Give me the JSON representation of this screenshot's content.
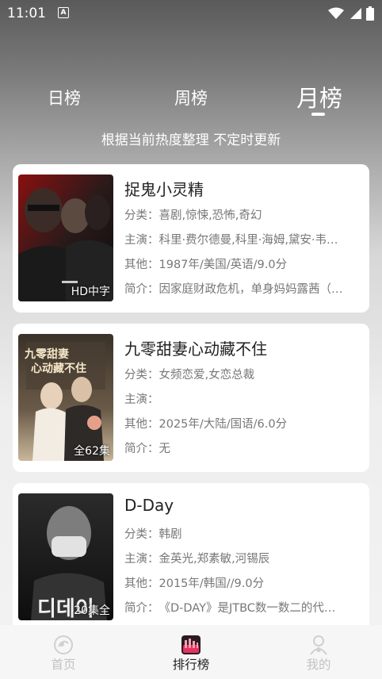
{
  "status_bar": {
    "time": "11:01"
  },
  "tabs": {
    "day": "日榜",
    "week": "周榜",
    "month": "月榜",
    "active": "月榜"
  },
  "subtitle": "根据当前热度整理 不定时更新",
  "labels": {
    "genre": "分类：",
    "cast": "主演：",
    "other": "其他：",
    "intro": "简介："
  },
  "cards": [
    {
      "title": "捉鬼小灵精",
      "badge": "HD中字",
      "genre": "喜剧,惊悚,恐怖,奇幻",
      "cast": "科里·费尔德曼,科里·海姆,黛安·韦…",
      "other": "1987年/美国/英语/9.0分",
      "intro": "因家庭财政危机，单身妈妈露茜（…"
    },
    {
      "title": "九零甜妻心动藏不住",
      "badge": "全62集",
      "genre": "女频恋爱,女恋总裁",
      "cast": "",
      "other": "2025年/大陆/国语/6.0分",
      "intro": "无"
    },
    {
      "title": "D-Day",
      "badge": "20集全",
      "genre": "韩剧",
      "cast": "金英光,郑素敏,河锡辰",
      "other": "2015年/韩国//9.0分",
      "intro": "《D-DAY》是JTBC数一数二的代…"
    }
  ],
  "nav": {
    "home": "首页",
    "ranking": "排行榜",
    "mine": "我的"
  }
}
